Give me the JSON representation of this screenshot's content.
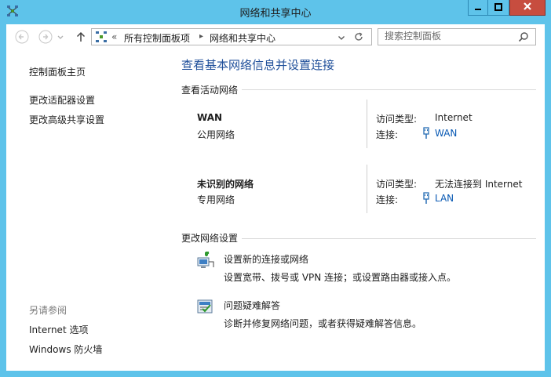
{
  "window": {
    "title": "网络和共享中心",
    "icon": "network-center-icon"
  },
  "nav": {
    "back": "back-arrow-icon",
    "forward": "forward-arrow-icon",
    "up": "up-arrow-icon"
  },
  "address": {
    "overflow": "«",
    "crumb1": "所有控制面板项",
    "sep": "▸",
    "crumb2": "网络和共享中心"
  },
  "search": {
    "placeholder": "搜索控制面板"
  },
  "sidebar": {
    "home": "控制面板主页",
    "items": [
      "更改适配器设置",
      "更改高级共享设置"
    ],
    "see_also_title": "另请参阅",
    "see_also": [
      "Internet 选项",
      "Windows 防火墙"
    ]
  },
  "main": {
    "heading": "查看基本网络信息并设置连接",
    "active_title": "查看活动网络",
    "networks": [
      {
        "name": "WAN",
        "category": "公用网络",
        "access_label": "访问类型:",
        "access_value": "Internet",
        "conn_label": "连接:",
        "conn_value": "WAN"
      },
      {
        "name": "未识别的网络",
        "category": "专用网络",
        "access_label": "访问类型:",
        "access_value": "无法连接到 Internet",
        "conn_label": "连接:",
        "conn_value": "LAN"
      }
    ],
    "change_title": "更改网络设置",
    "tasks": [
      {
        "title": "设置新的连接或网络",
        "desc": "设置宽带、拨号或 VPN 连接；或设置路由器或接入点。"
      },
      {
        "title": "问题疑难解答",
        "desc": "诊断并修复网络问题，或者获得疑难解答信息。"
      }
    ]
  },
  "colors": {
    "frame": "#5ec3ea",
    "close": "#c74d3f",
    "link": "#0a5ab4",
    "heading": "#1f4f9a"
  }
}
